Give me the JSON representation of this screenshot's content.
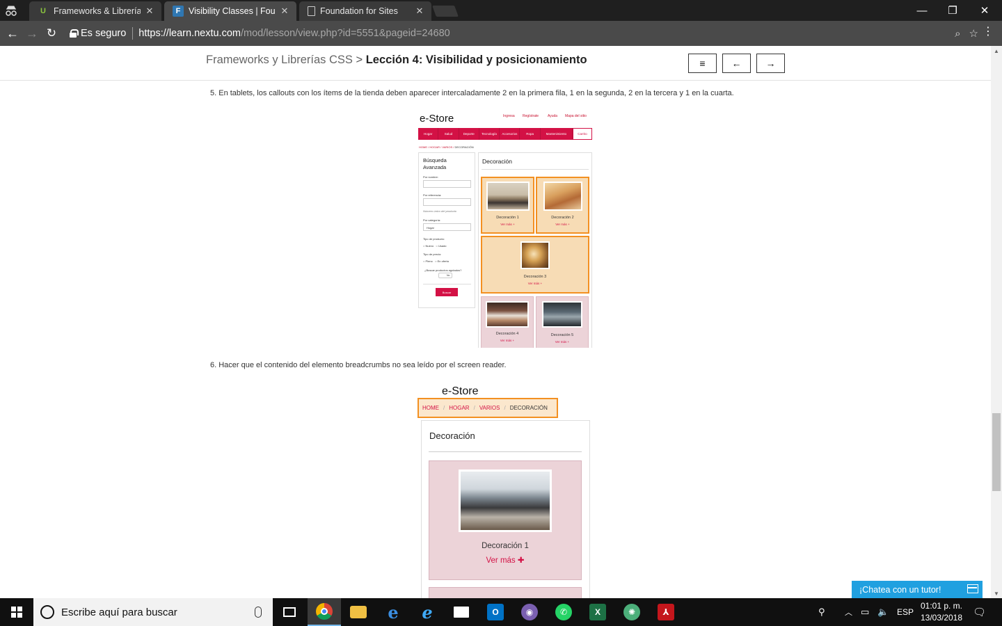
{
  "browser": {
    "tabs": [
      {
        "title": "Frameworks & Librerías C",
        "favicon": "nextu-icon",
        "active": false
      },
      {
        "title": "Visibility Classes | Founda",
        "favicon": "foundation-icon",
        "active": true
      },
      {
        "title": "Foundation for Sites",
        "favicon": "page-icon",
        "active": false
      }
    ],
    "secure_label": "Es seguro",
    "url_base": "https://learn.nextu.com",
    "url_path": "/mod/lesson/view.php?id=5551&pageid=24680"
  },
  "lesson": {
    "course": "Frameworks y Librerías CSS",
    "separator": ">",
    "title": "Lección 4: Visibilidad y posicionamiento",
    "menu_icon": "≡",
    "prev_icon": "←",
    "next_icon": "→"
  },
  "content": {
    "step5": "5. En tablets, los callouts con los ítems de la tienda deben aparecer intercaladamente 2 en la primera fila, 1 en la segunda, 2 en la tercera y 1 en la cuarta.",
    "step6": "6. Hacer que el contenido del elemento breadcrumbs no sea leído por el screen reader."
  },
  "estore1": {
    "logo": "e-Store",
    "top_links": [
      "Ingresa",
      "Regístrate",
      "Ayuda",
      "Mapa del sitio"
    ],
    "nav": [
      "Hogar",
      "Salud",
      "Deporte",
      "Tecnología",
      "Accesorios",
      "Ropa",
      "Mantenimiento"
    ],
    "cart": "Carrito",
    "breadcrumbs": [
      "HOME",
      "HOGAR",
      "VARIOS",
      "DECORACIÓN"
    ],
    "search_title": "Búsqueda Avanzada",
    "by_name": "Por nombre:",
    "by_ref": "Por referencia:",
    "ref_hint": "Número único del producto",
    "by_category": "Por categoría:",
    "category_value": "Hogar",
    "product_type": "Tipo de producto:",
    "type_options": [
      "Nuevo",
      "Usado"
    ],
    "price_type": "Tipo de precio:",
    "price_options": [
      "Pleno",
      "En oferta"
    ],
    "sold_out_q": "¿Buscar productos agotados?",
    "toggle": "No",
    "search_btn": "Buscar",
    "section_title": "Decoración",
    "cards": [
      {
        "name": "Decoración 1",
        "more": "Ver más +"
      },
      {
        "name": "Decoración 2",
        "more": "Ver más +"
      },
      {
        "name": "Decoración 3",
        "more": "Ver más +"
      },
      {
        "name": "Decoración 4",
        "more": "Ver más +"
      },
      {
        "name": "Decoración 5",
        "more": "Ver más +"
      }
    ]
  },
  "estore2": {
    "logo": "e-Store",
    "breadcrumbs": [
      "HOME",
      "HOGAR",
      "VARIOS",
      "DECORACIÓN"
    ],
    "crumb_sep": "/",
    "section_title": "Decoración",
    "card_name": "Decoración 1",
    "card_more": "Ver más ✚"
  },
  "chat": {
    "label": "¡Chatea con un tutor!"
  },
  "taskbar": {
    "search_placeholder": "Escribe aquí para buscar",
    "lang": "ESP",
    "time": "01:01 p. m.",
    "date": "13/03/2018"
  }
}
